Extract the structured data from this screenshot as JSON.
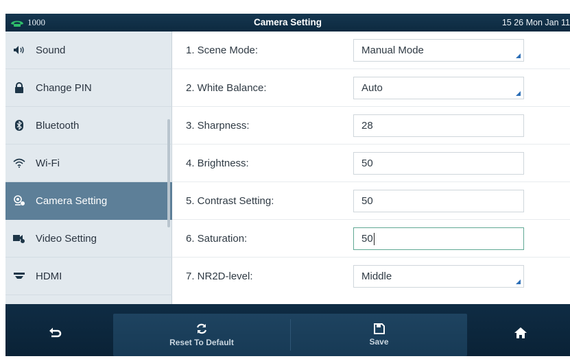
{
  "topbar": {
    "account": "1000",
    "title": "Camera Setting",
    "clock": "15 26 Mon Jan 11"
  },
  "sidebar": {
    "items": [
      {
        "label": "Sound",
        "icon": "speaker-icon"
      },
      {
        "label": "Change PIN",
        "icon": "lock-icon"
      },
      {
        "label": "Bluetooth",
        "icon": "bluetooth-icon"
      },
      {
        "label": "Wi-Fi",
        "icon": "wifi-icon"
      },
      {
        "label": "Camera Setting",
        "icon": "camera-setting-icon",
        "active": true
      },
      {
        "label": "Video Setting",
        "icon": "video-setting-icon"
      },
      {
        "label": "HDMI",
        "icon": "hdmi-icon"
      }
    ]
  },
  "settings": [
    {
      "label": "1. Scene Mode:",
      "value": "Manual Mode",
      "type": "select"
    },
    {
      "label": "2. White Balance:",
      "value": "Auto",
      "type": "select"
    },
    {
      "label": "3. Sharpness:",
      "value": "28",
      "type": "input"
    },
    {
      "label": "4. Brightness:",
      "value": "50",
      "type": "input"
    },
    {
      "label": "5. Contrast Setting:",
      "value": "50",
      "type": "input"
    },
    {
      "label": "6. Saturation:",
      "value": "50",
      "type": "input",
      "focused": true
    },
    {
      "label": "7. NR2D-level:",
      "value": "Middle",
      "type": "select"
    }
  ],
  "toolbar": {
    "back_icon": "back-arrow-icon",
    "reset_label": "Reset To Default",
    "save_label": "Save",
    "home_icon": "home-icon"
  },
  "colors": {
    "active_item": "#5d7f98",
    "topbar": "#15364f",
    "focus_border": "#5fa894",
    "select_corner": "#2d6fb6"
  }
}
